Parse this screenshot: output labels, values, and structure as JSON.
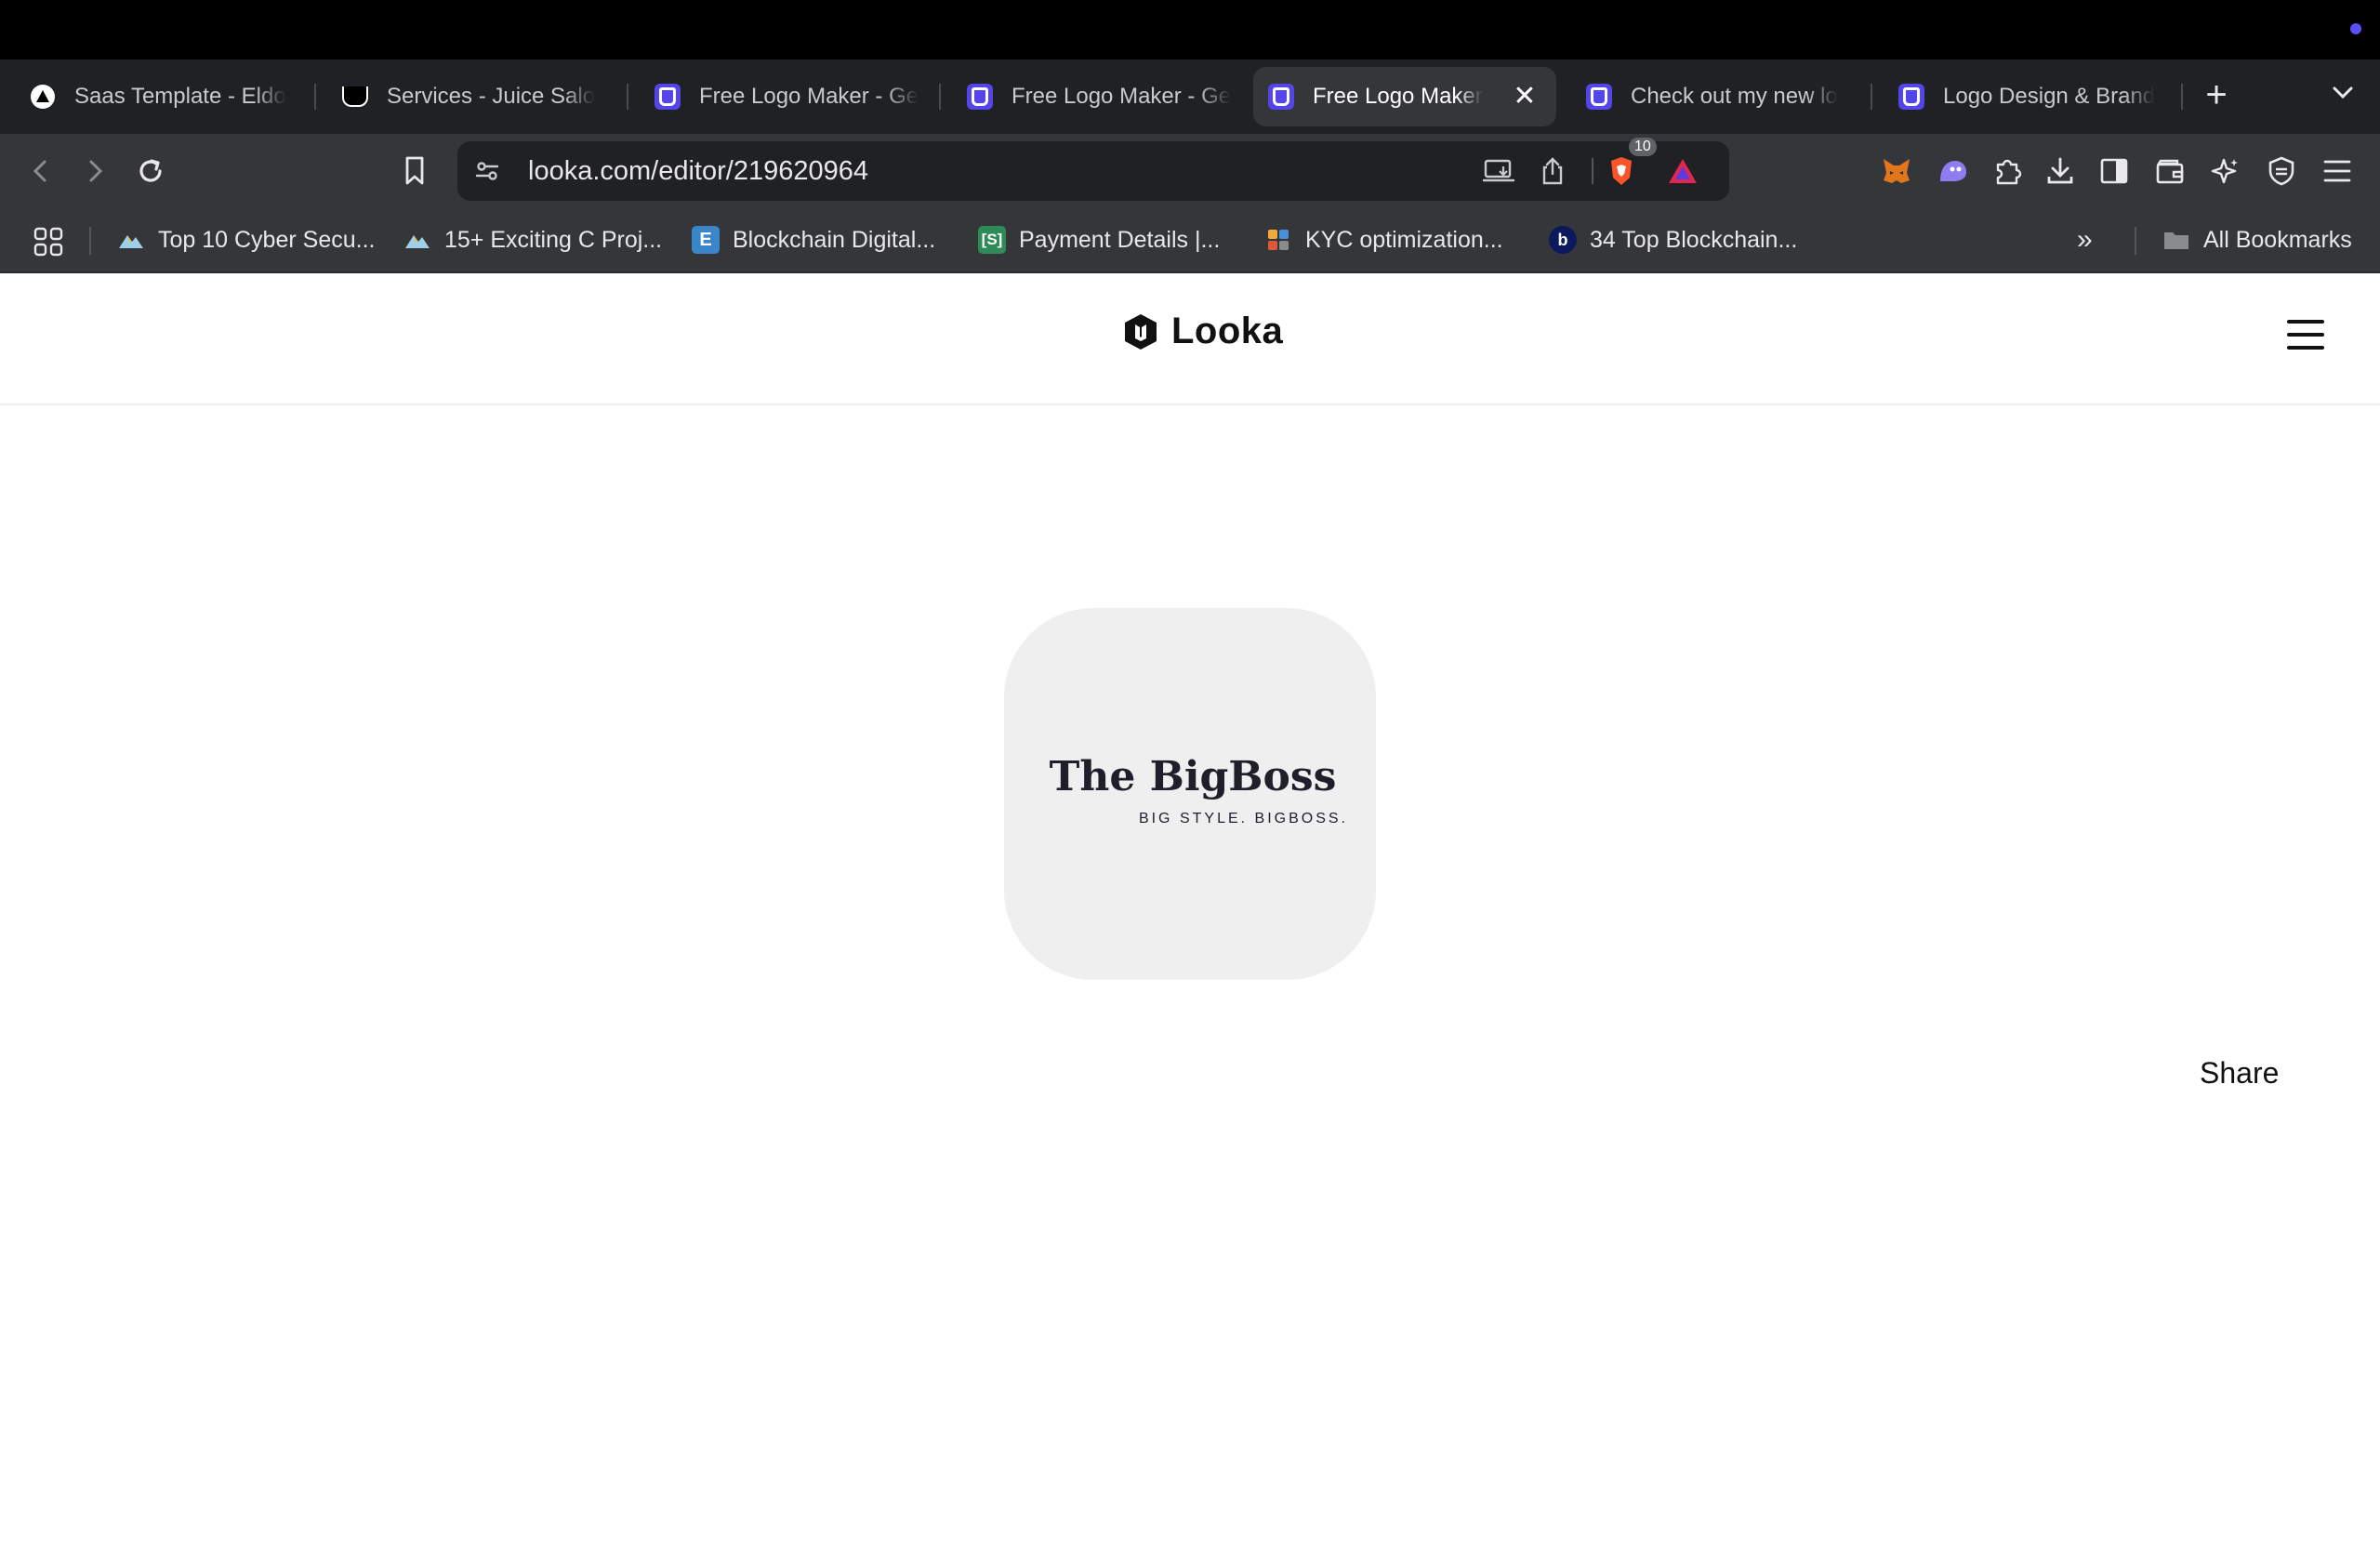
{
  "browser": {
    "tabs": [
      {
        "title": "Saas Template - Eldo",
        "favicon": "triangle-icon",
        "active": false
      },
      {
        "title": "Services - Juice Salo",
        "favicon": "juice-icon",
        "active": false
      },
      {
        "title": "Free Logo Maker - Ge",
        "favicon": "looka-icon",
        "active": false
      },
      {
        "title": "Free Logo Maker - Ge",
        "favicon": "looka-icon",
        "active": false
      },
      {
        "title": "Free Logo Maker",
        "favicon": "looka-icon",
        "active": true
      },
      {
        "title": "Check out my new lo",
        "favicon": "looka-icon",
        "active": false
      },
      {
        "title": "Logo Design & Brand",
        "favicon": "looka-icon",
        "active": false
      }
    ],
    "close_tab_symbol": "✕",
    "new_tab_symbol": "+",
    "tab_list_symbol": "⌄",
    "url": "looka.com/editor/219620964",
    "shields_count": "10",
    "bookmarks": [
      {
        "label": "Top 10 Cyber Secu...",
        "icon": "mountain-icon"
      },
      {
        "label": "15+ Exciting C Proj...",
        "icon": "mountain-icon"
      },
      {
        "label": "Blockchain Digital...",
        "icon": "e-icon",
        "badge": "E"
      },
      {
        "label": "Payment Details |...",
        "icon": "dollar-icon",
        "badge": "[S]"
      },
      {
        "label": "KYC optimization...",
        "icon": "kyc-icon"
      },
      {
        "label": "34 Top Blockchain...",
        "icon": "b-icon",
        "badge": "b"
      }
    ],
    "bookmarks_overflow": "»",
    "all_bookmarks": "All Bookmarks"
  },
  "page": {
    "brand_name": "Looka",
    "logo": {
      "title": "The BigBoss",
      "tagline": "BIG STYLE. BIGBOSS."
    },
    "share_label": "Share"
  },
  "colors": {
    "looka_accent": "#5345ea",
    "card_bg": "#efefef",
    "logo_text": "#1e1f2a"
  }
}
